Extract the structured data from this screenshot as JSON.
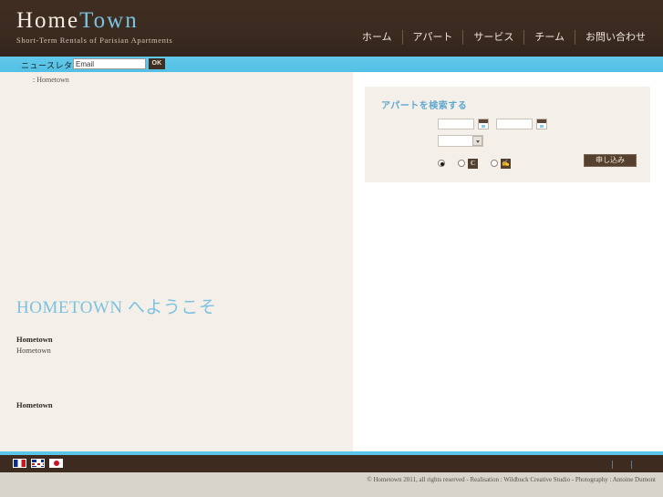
{
  "header": {
    "logo": {
      "part1": "Home",
      "part2": "Town",
      "tagline": "Short-Term Rentals of Parisian Apartments",
      "color_part1": "#f3ece2",
      "color_part2": "#79c3e3"
    },
    "nav": [
      {
        "label": "ホーム"
      },
      {
        "label": "アパート"
      },
      {
        "label": "サービス"
      },
      {
        "label": "チーム"
      },
      {
        "label": "お問い合わせ"
      }
    ]
  },
  "newsletter": {
    "label": "ニュースレター",
    "input_value": "Email",
    "input_placeholder": "Email",
    "ok_label": "OK",
    "bar_color": "#5cc6e8"
  },
  "content": {
    "breadcrumb": ": Hometown",
    "welcome_title": "HOMETOWN へようこそ",
    "welcome_title_color": "#7cc1e0",
    "paragraph_heading": "Hometown",
    "paragraph_text": "Hometown",
    "secondary_heading": "Hometown"
  },
  "search": {
    "title": "アパートを検索する",
    "title_color": "#5fa8cd",
    "date_from_value": "",
    "date_from_placeholder": "",
    "date_to_value": "",
    "date_to_placeholder": "",
    "select_value": "",
    "calendar_icon_name": "calendar-icon",
    "radios": [
      {
        "id": "radio-1",
        "checked": true,
        "icon": ""
      },
      {
        "id": "radio-2",
        "checked": false,
        "icon": "C"
      },
      {
        "id": "radio-3",
        "checked": false,
        "icon": "✍"
      }
    ],
    "submit_label": "申し込み",
    "submit_color": "#56412f"
  },
  "footer": {
    "flags": [
      {
        "name": "flag-france",
        "label": "FR"
      },
      {
        "name": "flag-uk",
        "label": "EN"
      },
      {
        "name": "flag-japan",
        "label": "JA"
      }
    ],
    "links": [
      {
        "label": ""
      },
      {
        "label": ""
      }
    ],
    "copyright": "© Hometown 2011, all rights reserved - Realisation : Wildbuck Creative Studio - Photography : Antoine Dumont"
  }
}
